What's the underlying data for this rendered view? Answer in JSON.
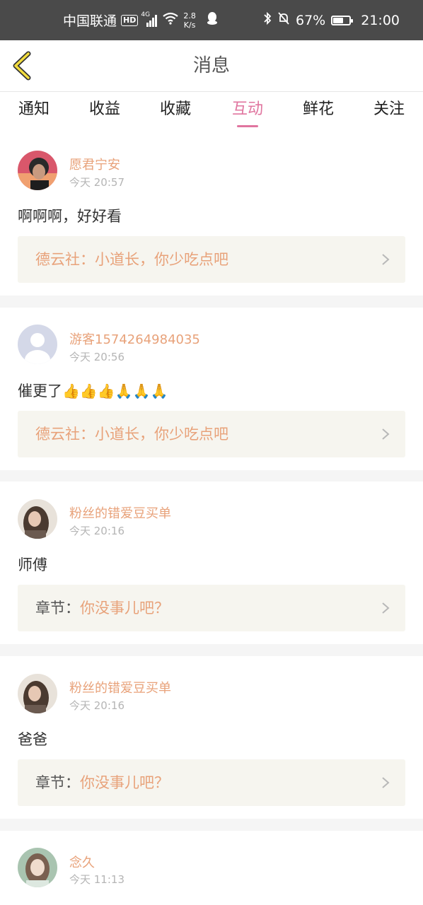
{
  "status_bar": {
    "carrier": "中国联通",
    "hd": "HD",
    "network": "4G",
    "speed_value": "2.8",
    "speed_unit": "K/s",
    "battery": "67%",
    "battery_level": 0.67,
    "time": "21:00"
  },
  "header": {
    "title": "消息",
    "back_icon": "back-chevron-icon"
  },
  "tabs": [
    {
      "label": "通知",
      "active": false
    },
    {
      "label": "收益",
      "active": false
    },
    {
      "label": "收藏",
      "active": false
    },
    {
      "label": "互动",
      "active": true
    },
    {
      "label": "鲜花",
      "active": false
    },
    {
      "label": "关注",
      "active": false
    }
  ],
  "colors": {
    "accent": "#e0759f",
    "name": "#e8a27a",
    "ref_bg": "#f6f5ef",
    "status_bar": "#4a4a4a"
  },
  "messages": [
    {
      "name": "愿君宁安",
      "time": "今天 20:57",
      "comment": "啊啊啊，好好看",
      "ref_prefix": "德云社：",
      "ref_body": "小道长，你少吃点吧",
      "avatar": "avatar-photo-man"
    },
    {
      "name": "游客1574264984035",
      "time": "今天 20:56",
      "comment": "催更了",
      "comment_emojis": "👍👍👍🙏🙏🙏",
      "ref_prefix": "德云社：",
      "ref_body": "小道长，你少吃点吧",
      "avatar": "avatar-default-guest"
    },
    {
      "name": "粉丝的错爱豆买单",
      "time": "今天 20:16",
      "comment": "师傅",
      "ref_prefix": "章节：",
      "ref_body": "你没事儿吧？",
      "avatar": "avatar-photo-woman"
    },
    {
      "name": "粉丝的错爱豆买单",
      "time": "今天 20:16",
      "comment": "爸爸",
      "ref_prefix": "章节：",
      "ref_body": "你没事儿吧？",
      "avatar": "avatar-photo-woman"
    },
    {
      "name": "念久",
      "time": "今天 11:13",
      "avatar": "avatar-photo-girl"
    }
  ]
}
